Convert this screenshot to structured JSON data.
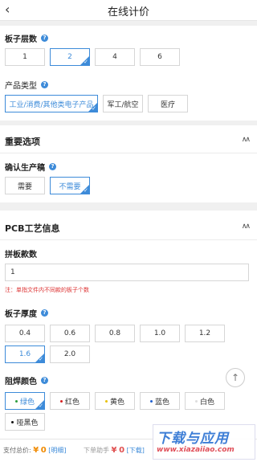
{
  "header": {
    "back_icon": "chevron-left-icon",
    "title": "在线计价"
  },
  "board_layers": {
    "label": "板子层数",
    "options": [
      "1",
      "2",
      "4",
      "6"
    ],
    "selected": "2"
  },
  "product_type": {
    "label": "产品类型",
    "options": [
      "工业/消费/其他类电子产品",
      "军工/航空",
      "医疗"
    ],
    "selected": "工业/消费/其他类电子产品"
  },
  "important": {
    "title": "重要选项",
    "confirm_label": "确认生产稿",
    "options": [
      "需要",
      "不需要"
    ],
    "selected": "不需要"
  },
  "pcb": {
    "title": "PCB工艺信息",
    "panel_count_label": "拼板款数",
    "panel_count_value": "1",
    "panel_note": "注：单指文件内不同款的板子个数",
    "thickness_label": "板子厚度",
    "thickness_options": [
      "0.4",
      "0.6",
      "0.8",
      "1.0",
      "1.2",
      "1.6",
      "2.0"
    ],
    "thickness_selected": "1.6",
    "mask_label": "阻焊颜色",
    "mask_options": [
      {
        "label": "绿色",
        "color": "#2e9e3e"
      },
      {
        "label": "红色",
        "color": "#d62020"
      },
      {
        "label": "黄色",
        "color": "#e8c000"
      },
      {
        "label": "蓝色",
        "color": "#2060d0"
      },
      {
        "label": "白色",
        "color": "#dddddd"
      },
      {
        "label": "哑黑色",
        "color": "#111111"
      }
    ],
    "mask_selected": "绿色"
  },
  "footer": {
    "pay_label": "支付总价:",
    "pay_currency": "¥",
    "pay_amount": "0",
    "pay_link": "[明细]",
    "helper_label": "下单助手",
    "helper_currency": "¥",
    "helper_amount": "0",
    "helper_link": "[下载]"
  },
  "scroll_top_icon": "arrow-up-icon",
  "watermark": {
    "big": "下载与应用",
    "small": "www.xiazaiiao.com"
  },
  "colors": {
    "accent": "#3d8bd9",
    "price": "#f08a00",
    "note": "#d33333"
  }
}
